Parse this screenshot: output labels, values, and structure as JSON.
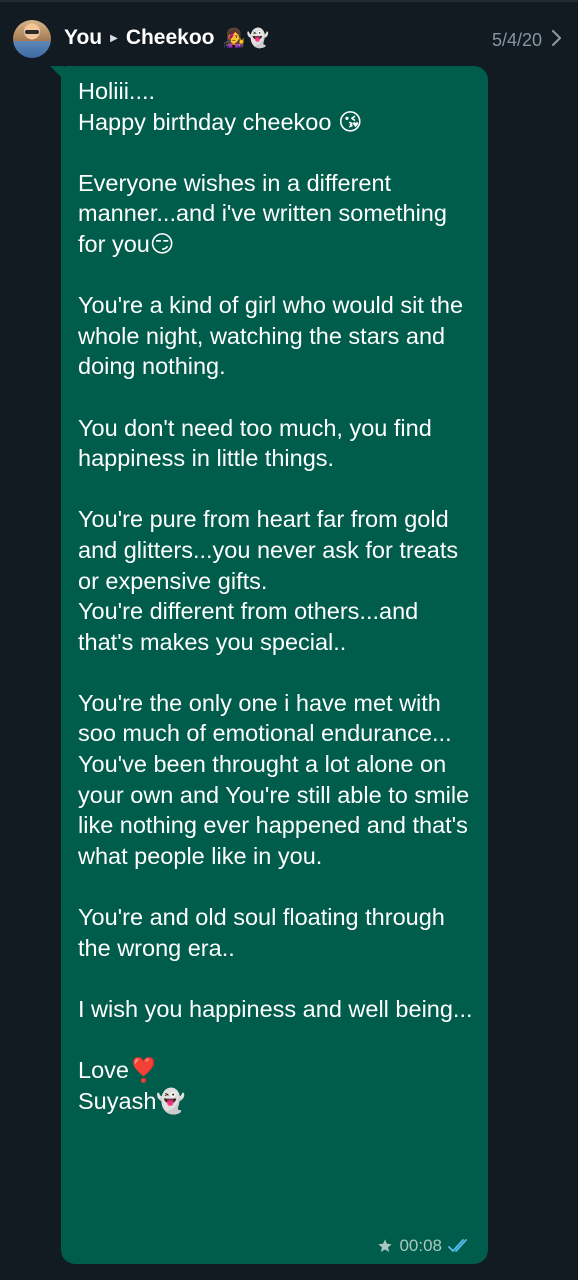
{
  "header": {
    "sender": "You",
    "recipient": "Cheekoo",
    "recipient_emojis": "👩‍🎤👻",
    "date": "5/4/20"
  },
  "message": {
    "text": "Holiii....\nHappy birthday cheekoo 😘\n\nEveryone wishes in a different manner...and i've written something for you😏\n\nYou're a kind of girl who would sit the whole night, watching the stars and doing nothing.\n\nYou don't need too much, you find happiness in little things.\n\nYou're pure from heart far from gold and glitters...you never ask for treats or expensive gifts.\nYou're different from others...and that's makes you special..\n\nYou're the only one i have met with soo much of emotional endurance...\nYou've been throught a lot alone on your own and You're still able to smile like nothing ever happened and that's what people like in you.\n\nYou're and old soul floating through the wrong era..\n\nI wish you happiness and well being...\n\nLove❣️\nSuyash👻",
    "time": "00:08",
    "starred": true,
    "status": "read"
  },
  "colors": {
    "background": "#121b22",
    "bubble": "#005c4b",
    "read_ticks": "#53bdeb",
    "meta_text": "#a8c8c0"
  },
  "icons": {
    "separator": "play-arrow-icon",
    "navigate": "chevron-right-icon",
    "star": "star-icon",
    "read_receipt": "double-check-icon"
  }
}
